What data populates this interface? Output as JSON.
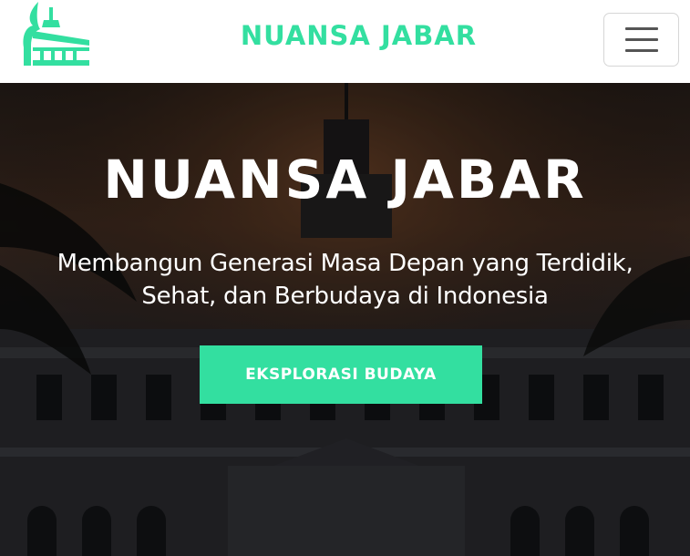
{
  "theme": {
    "accent": "#33dfa0"
  },
  "navbar": {
    "brand": "NUANSA JABAR",
    "logo_icon": "gedung-sate-logo-icon",
    "menu_icon": "hamburger-menu-icon"
  },
  "hero": {
    "title": "NUANSA JABAR",
    "subtitle": "Membangun Generasi Masa Depan yang Terdidik, Sehat, dan Berbudaya di Indonesia",
    "cta_label": "EKSPLORASI BUDAYA"
  }
}
